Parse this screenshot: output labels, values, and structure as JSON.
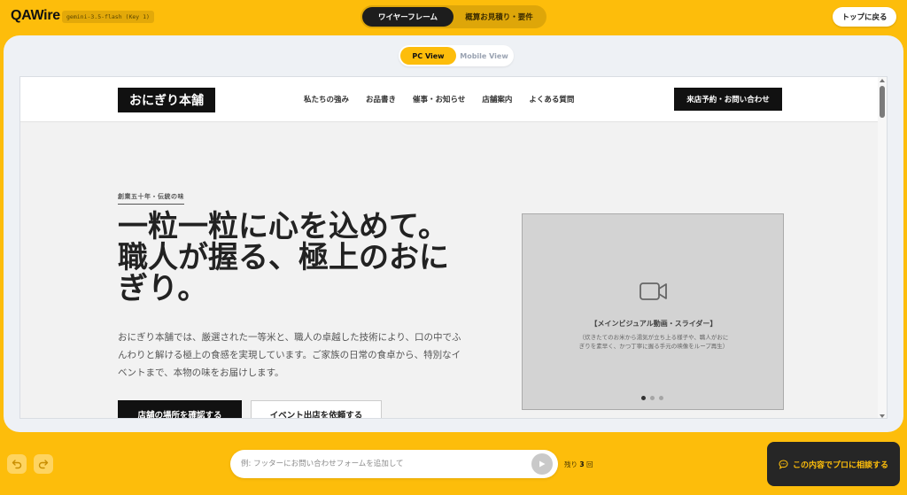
{
  "app": {
    "logo": "QAWire",
    "model_badge": "gemini-3.5-flash (Key 1)",
    "mode_tabs": [
      {
        "label": "ワイヤーフレーム",
        "active": true
      },
      {
        "label": "概算お見積り・要件",
        "active": false
      }
    ],
    "back_button": "トップに戻る"
  },
  "view_toggle": {
    "tabs": [
      {
        "label": "PC View",
        "active": true
      },
      {
        "label": "Mobile View",
        "active": false
      }
    ]
  },
  "site": {
    "logo": "おにぎり本舗",
    "nav": [
      "私たちの強み",
      "お品書き",
      "催事・お知らせ",
      "店舗案内",
      "よくある質問"
    ],
    "cta": "来店予約・お問い合わせ",
    "hero": {
      "eyebrow": "創業五十年・伝統の味",
      "headline": [
        "一粒一粒に心を込めて。",
        "職人が握る、極上のおに",
        "ぎり。"
      ],
      "lead": [
        "おにぎり本舗では、厳選された一等米と、職人の卓越した技術により、口の中でふ",
        "んわりと解ける極上の食感を実現しています。ご家族の日常の食卓から、特別なイ",
        "ベントまで、本物の味をお届けします。"
      ],
      "primary_button": "店舗の場所を確認する",
      "secondary_button": "イベント出店を依頼する",
      "media": {
        "icon": "video-camera-icon",
        "title": "【メインビジュアル動画・スライダー】",
        "description": [
          "（炊きたてのお米から湯気が立ち上る様子や、職人がおに",
          "ぎりを素早く、かつ丁寧に握る手元の映像をループ再生）"
        ],
        "slide_count": 3,
        "active_slide": 0
      }
    }
  },
  "bottom": {
    "chat_placeholder": "例: フッターにお問い合わせフォームを追加して",
    "remaining_prefix": "残り",
    "remaining_count": "3",
    "remaining_suffix": "回",
    "consult_button": "この内容でプロに相談する"
  },
  "colors": {
    "brand_yellow": "#fdbd0b",
    "dark": "#1d1d1d",
    "stage_bg": "#eef1f5"
  }
}
